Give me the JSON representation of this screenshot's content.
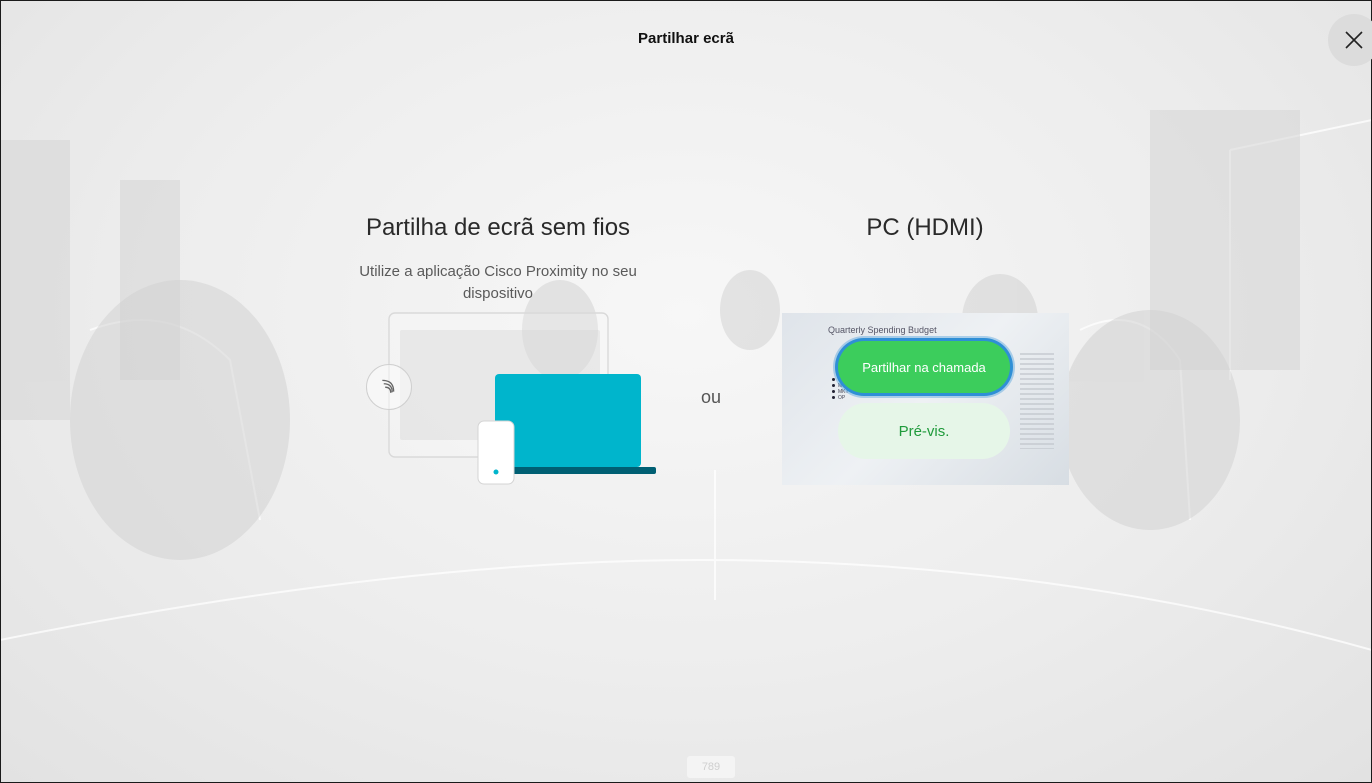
{
  "header": {
    "title": "Partilhar ecrã"
  },
  "close": {
    "icon": "close-icon"
  },
  "wireless": {
    "heading": "Partilha de ecrã sem fios",
    "description": "Utilize a aplicação Cisco Proximity no seu dispositivo",
    "icon": "wireless-broadcast-icon"
  },
  "separator": {
    "label": "ou"
  },
  "hdmi": {
    "heading": "PC (HDMI)",
    "preview_slide_title": "Quarterly Spending Budget",
    "legend": [
      "IT",
      "MST",
      "MKT",
      "OP"
    ],
    "share_button": "Partilhar na chamada",
    "preview_button": "Pré-vis."
  },
  "footer": {
    "page_number": "789"
  },
  "colors": {
    "share_green": "#3ccd5c",
    "focus_blue": "#2f8fd6",
    "preview_green_text": "#1f9a3b",
    "device_cyan": "#00b5cc"
  }
}
